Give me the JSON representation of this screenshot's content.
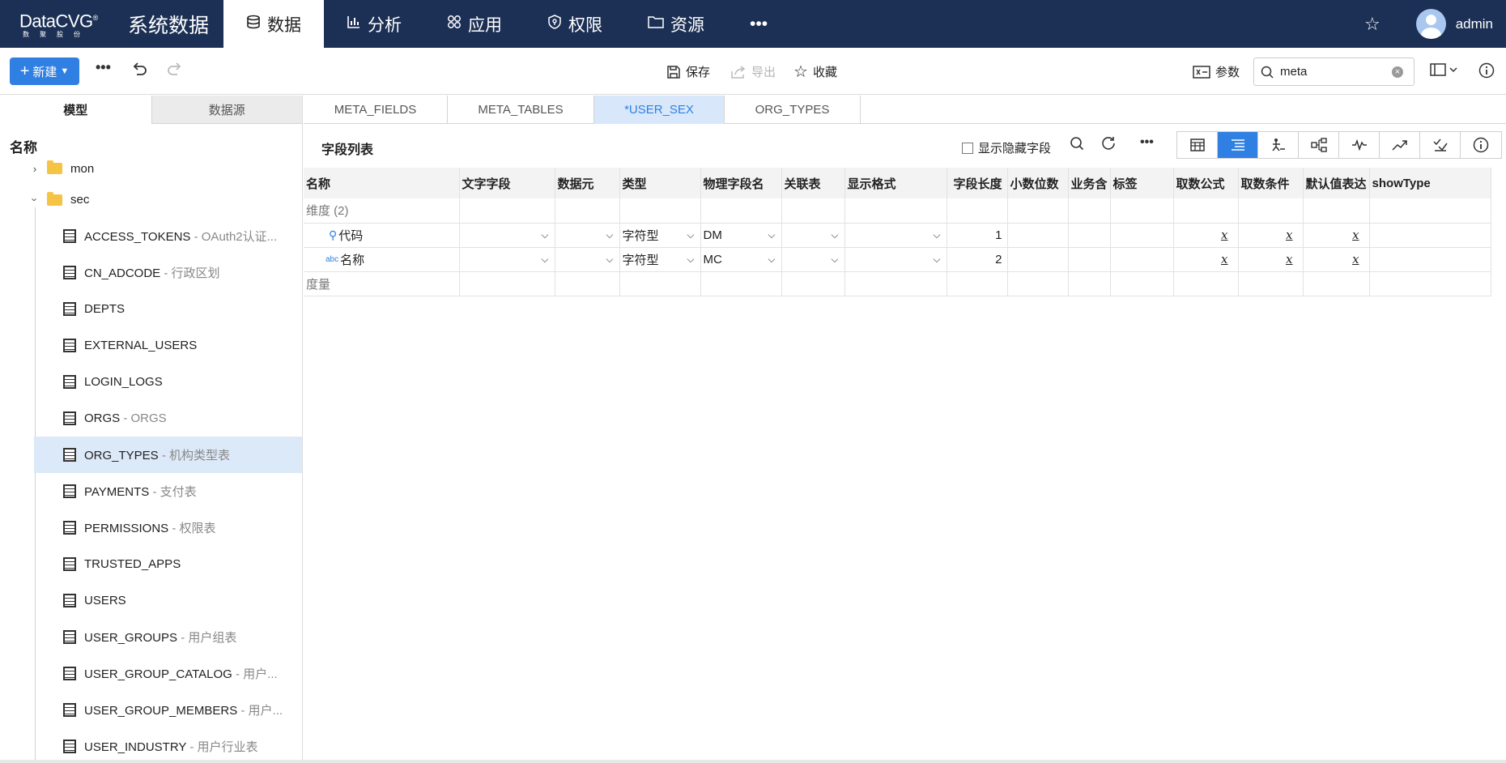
{
  "topbar": {
    "brand": "DataCVG",
    "brand_sub": "数聚股份",
    "app_title": "系统数据",
    "nav": [
      {
        "label": "数据",
        "icon": "database-icon",
        "active": true
      },
      {
        "label": "分析",
        "icon": "bar-chart-icon"
      },
      {
        "label": "应用",
        "icon": "apps-icon"
      },
      {
        "label": "权限",
        "icon": "shield-icon"
      },
      {
        "label": "资源",
        "icon": "folder-icon"
      },
      {
        "label": "•••",
        "icon": "more-icon"
      }
    ],
    "username": "admin"
  },
  "toolbar": {
    "new_label": "新建",
    "save_label": "保存",
    "export_label": "导出",
    "favorite_label": "收藏",
    "params_label": "参数",
    "search_value": "meta"
  },
  "left": {
    "tabs": [
      "模型",
      "数据源"
    ],
    "column_header": "名称",
    "folders": [
      {
        "name": "mon",
        "expanded": false
      },
      {
        "name": "sec",
        "expanded": true
      }
    ],
    "items": [
      {
        "name": "ACCESS_TOKENS",
        "desc": " - OAuth2认证..."
      },
      {
        "name": "CN_ADCODE",
        "desc": " - 行政区划"
      },
      {
        "name": "DEPTS",
        "desc": ""
      },
      {
        "name": "EXTERNAL_USERS",
        "desc": ""
      },
      {
        "name": "LOGIN_LOGS",
        "desc": ""
      },
      {
        "name": "ORGS",
        "desc": " - ORGS"
      },
      {
        "name": "ORG_TYPES",
        "desc": " - 机构类型表",
        "selected": true
      },
      {
        "name": "PAYMENTS",
        "desc": " - 支付表"
      },
      {
        "name": "PERMISSIONS",
        "desc": " - 权限表"
      },
      {
        "name": "TRUSTED_APPS",
        "desc": ""
      },
      {
        "name": "USERS",
        "desc": ""
      },
      {
        "name": "USER_GROUPS",
        "desc": " - 用户组表"
      },
      {
        "name": "USER_GROUP_CATALOG",
        "desc": " - 用户..."
      },
      {
        "name": "USER_GROUP_MEMBERS",
        "desc": " - 用户..."
      },
      {
        "name": "USER_INDUSTRY",
        "desc": " - 用户行业表"
      }
    ]
  },
  "doc_tabs": [
    "META_FIELDS",
    "META_TABLES",
    "*USER_SEX",
    "ORG_TYPES"
  ],
  "active_doc_tab": "*USER_SEX",
  "field_list": {
    "title": "字段列表",
    "show_hidden_label": "显示隐藏字段",
    "columns": [
      "名称",
      "文字字段",
      "数据元",
      "类型",
      "物理字段名",
      "关联表",
      "显示格式",
      "字段长度",
      "小数位数",
      "业务含",
      "标签",
      "取数公式",
      "取数条件",
      "默认值表达",
      "showType"
    ],
    "dimension_group": "维度 (2)",
    "measure_group": "度量",
    "rows": [
      {
        "name": "代码",
        "icon": "key-icon",
        "type": "字符型",
        "physical": "DM",
        "length": "1",
        "fx": "x"
      },
      {
        "name": "名称",
        "icon": "abc-icon",
        "type": "字符型",
        "physical": "MC",
        "length": "2",
        "fx": "x"
      }
    ]
  },
  "colors": {
    "nav_bg": "#1c3055",
    "accent": "#2f80e2",
    "selected_row": "#dce9f8"
  }
}
